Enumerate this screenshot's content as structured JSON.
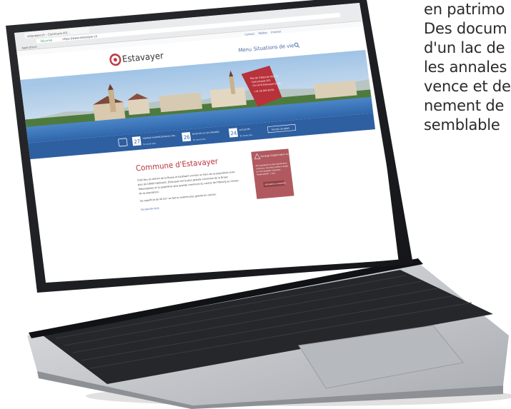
{
  "side_text": {
    "lines": [
      "en patrimo",
      "Des docum",
      "d'un lac de",
      "les annales",
      "vence et de",
      "nement de",
      "semblable"
    ]
  },
  "browser": {
    "tab_title": "estavayer.ch – Commune d'E...",
    "url": "https://www.estavayer.ch",
    "secure_label": "Sécurisé",
    "bookmark": "Applications"
  },
  "website": {
    "top_links": [
      "Contact",
      "Médias",
      "Intranet"
    ],
    "logo_text": "Estavayer",
    "nav": {
      "menu": "Menu",
      "situations": "Situations de vie"
    },
    "hero_card": {
      "line1": "Rue de l'Hôtel de Ville 11",
      "line2": "Case postale 623",
      "line3": "CH-1470 Estavayer-le-Lac",
      "phone": "+41 26 664 80 60"
    },
    "info_bar": [
      {
        "day": "27",
        "title": "SONDAGE D'APPRÉCIATION DU SITE...",
        "more": "En savoir plus"
      },
      {
        "day": "26",
        "title": "MICRO DE LYS (LES ORIGINES)",
        "more": "En savoir plus"
      },
      {
        "day": "24",
        "title": "ACTUALITÉS",
        "more": "En savoir plus"
      }
    ],
    "info_bar_button": "TOUTES LES NEWS",
    "section_title": "Commune d'Estavayer",
    "intro_paragraph": "Chef-lieu du district de la Broye et totalisant environ un tiers de sa population avec plus de 10000 habitants, Estavayer est la plus grande commune de la Broye fribourgeoise et la quatrième plus grande commune du canton de Fribourg au niveau de sa population.",
    "area_paragraph": "Sa superficie de 40 km² en fait la sixième plus grande du canton.",
    "read_more": "EN SAVOIR PLUS",
    "survey_card": {
      "title": "Sondage d'appréciation du site internet",
      "body": "Afin d'améliorer le site internet de la commune, vous êtes invités à remplir le court sondage ci-dessous. Temps estimé : 1 min.",
      "button": "RÉPONDRE AU SONDAGE"
    }
  },
  "colors": {
    "brand_red": "#b8313b",
    "survey_card": "#b05a5f",
    "info_bar": "#2e5fa0",
    "laptop_frame": "#1c1d20",
    "laptop_body": "#c4c6ca",
    "keyboard": "#25272b"
  },
  "icons": [
    "logo-icon",
    "search-icon",
    "calendar-icon",
    "warning-icon"
  ]
}
